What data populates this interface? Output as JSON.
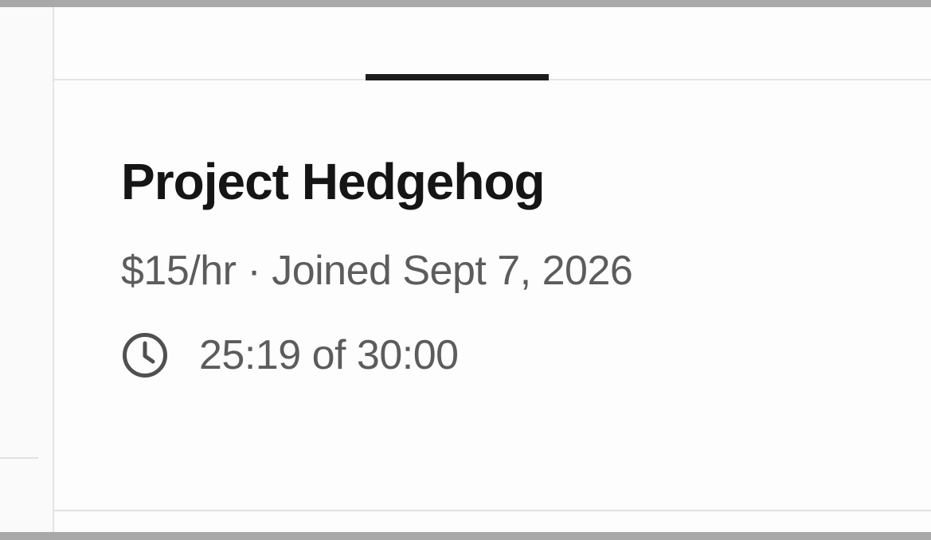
{
  "project": {
    "name": "Project Hedgehog",
    "rate": "$15/hr",
    "separator": "·",
    "joined": "Joined Sept 7, 2026"
  },
  "timer": {
    "icon": "clock-icon",
    "elapsed": "25:19",
    "connector": "of",
    "limit": "30:00"
  },
  "colors": {
    "title": "#151515",
    "secondary_text": "#5c5c5c",
    "tab_indicator": "#1c1c1c",
    "window_border": "#a9a9a9"
  }
}
